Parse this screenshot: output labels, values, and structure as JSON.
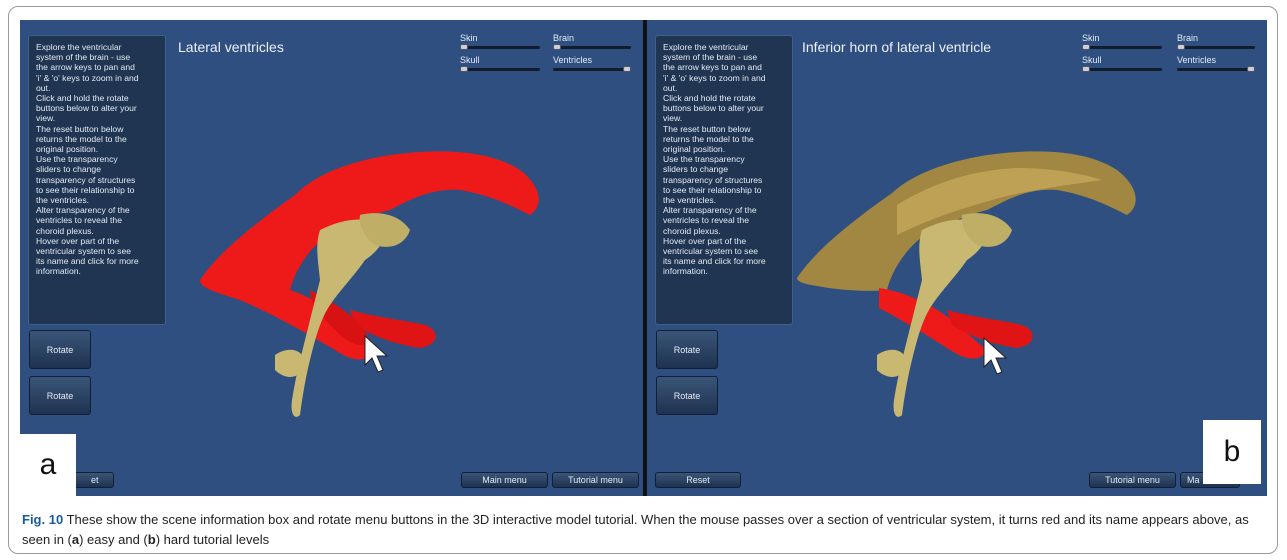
{
  "panel_a": {
    "letter": "a",
    "title": "Lateral ventricles",
    "info_text": "Explore the ventricular\nsystem of the brain - use\nthe arrow keys to pan and\n'i' & 'o' keys to zoom in and\nout.\nClick and hold the rotate\nbuttons below to alter your\nview.\nThe reset button below\nreturns the model to the\noriginal position.\nUse the transparency\nsliders to change\ntransparency of structures\nto see their relationship to\nthe ventricles.\nAlter transparency of the\nventricles to reveal the\nchoroid plexus.\nHover over part of the\nventricular system to see\nits name and click for more\ninformation.",
    "sliders": [
      {
        "label": "Skin",
        "value": 0.0
      },
      {
        "label": "Brain",
        "value": 0.0
      },
      {
        "label": "Skull",
        "value": 0.0
      },
      {
        "label": "Ventricles",
        "value": 1.0
      }
    ],
    "rotate_buttons": [
      "Rotate",
      "Rotate"
    ],
    "reset_label": "Reset",
    "reset_visible": "et",
    "main_menu": "Main menu",
    "tutorial_menu": "Tutorial menu"
  },
  "panel_b": {
    "letter": "b",
    "title": "Inferior horn of lateral ventricle",
    "info_text": "Explore the ventricular\nsystem of the brain - use\nthe arrow keys to pan and\n'i' & 'o' keys to zoom in and\nout.\nClick and hold the rotate\nbuttons below to alter your\nview.\nThe reset button below\nreturns the model to the\noriginal position.\nUse the transparency\nsliders to change\ntransparency of structures\nto see their relationship to\nthe ventricles.\nAlter transparency of the\nventricles to reveal the\nchoroid plexus.\nHover over part of the\nventricular system to see\nits name and click for more\ninformation.",
    "sliders": [
      {
        "label": "Skin",
        "value": 0.0
      },
      {
        "label": "Brain",
        "value": 0.0
      },
      {
        "label": "Skull",
        "value": 0.0
      },
      {
        "label": "Ventricles",
        "value": 1.0
      }
    ],
    "rotate_buttons": [
      "Rotate",
      "Rotate"
    ],
    "reset_label": "Reset",
    "tutorial_menu": "Tutorial menu",
    "main_menu_partial": "Ma"
  },
  "caption": {
    "fig_label": "Fig. 10",
    "text_1": " These show the scene information box and rotate menu buttons in the 3D interactive model tutorial. When the mouse passes over a section of ventricular system, it turns red and its name appears above, as seen in (",
    "a": "a",
    "text_2": ") easy and (",
    "b": "b",
    "text_3": ") hard tutorial levels"
  },
  "colors": {
    "viewport_bg": "#2e4f80",
    "highlight_red": "#ee1a1a",
    "ventricle_tan": "#c8b872",
    "caption_fig": "#1a5a9a"
  }
}
